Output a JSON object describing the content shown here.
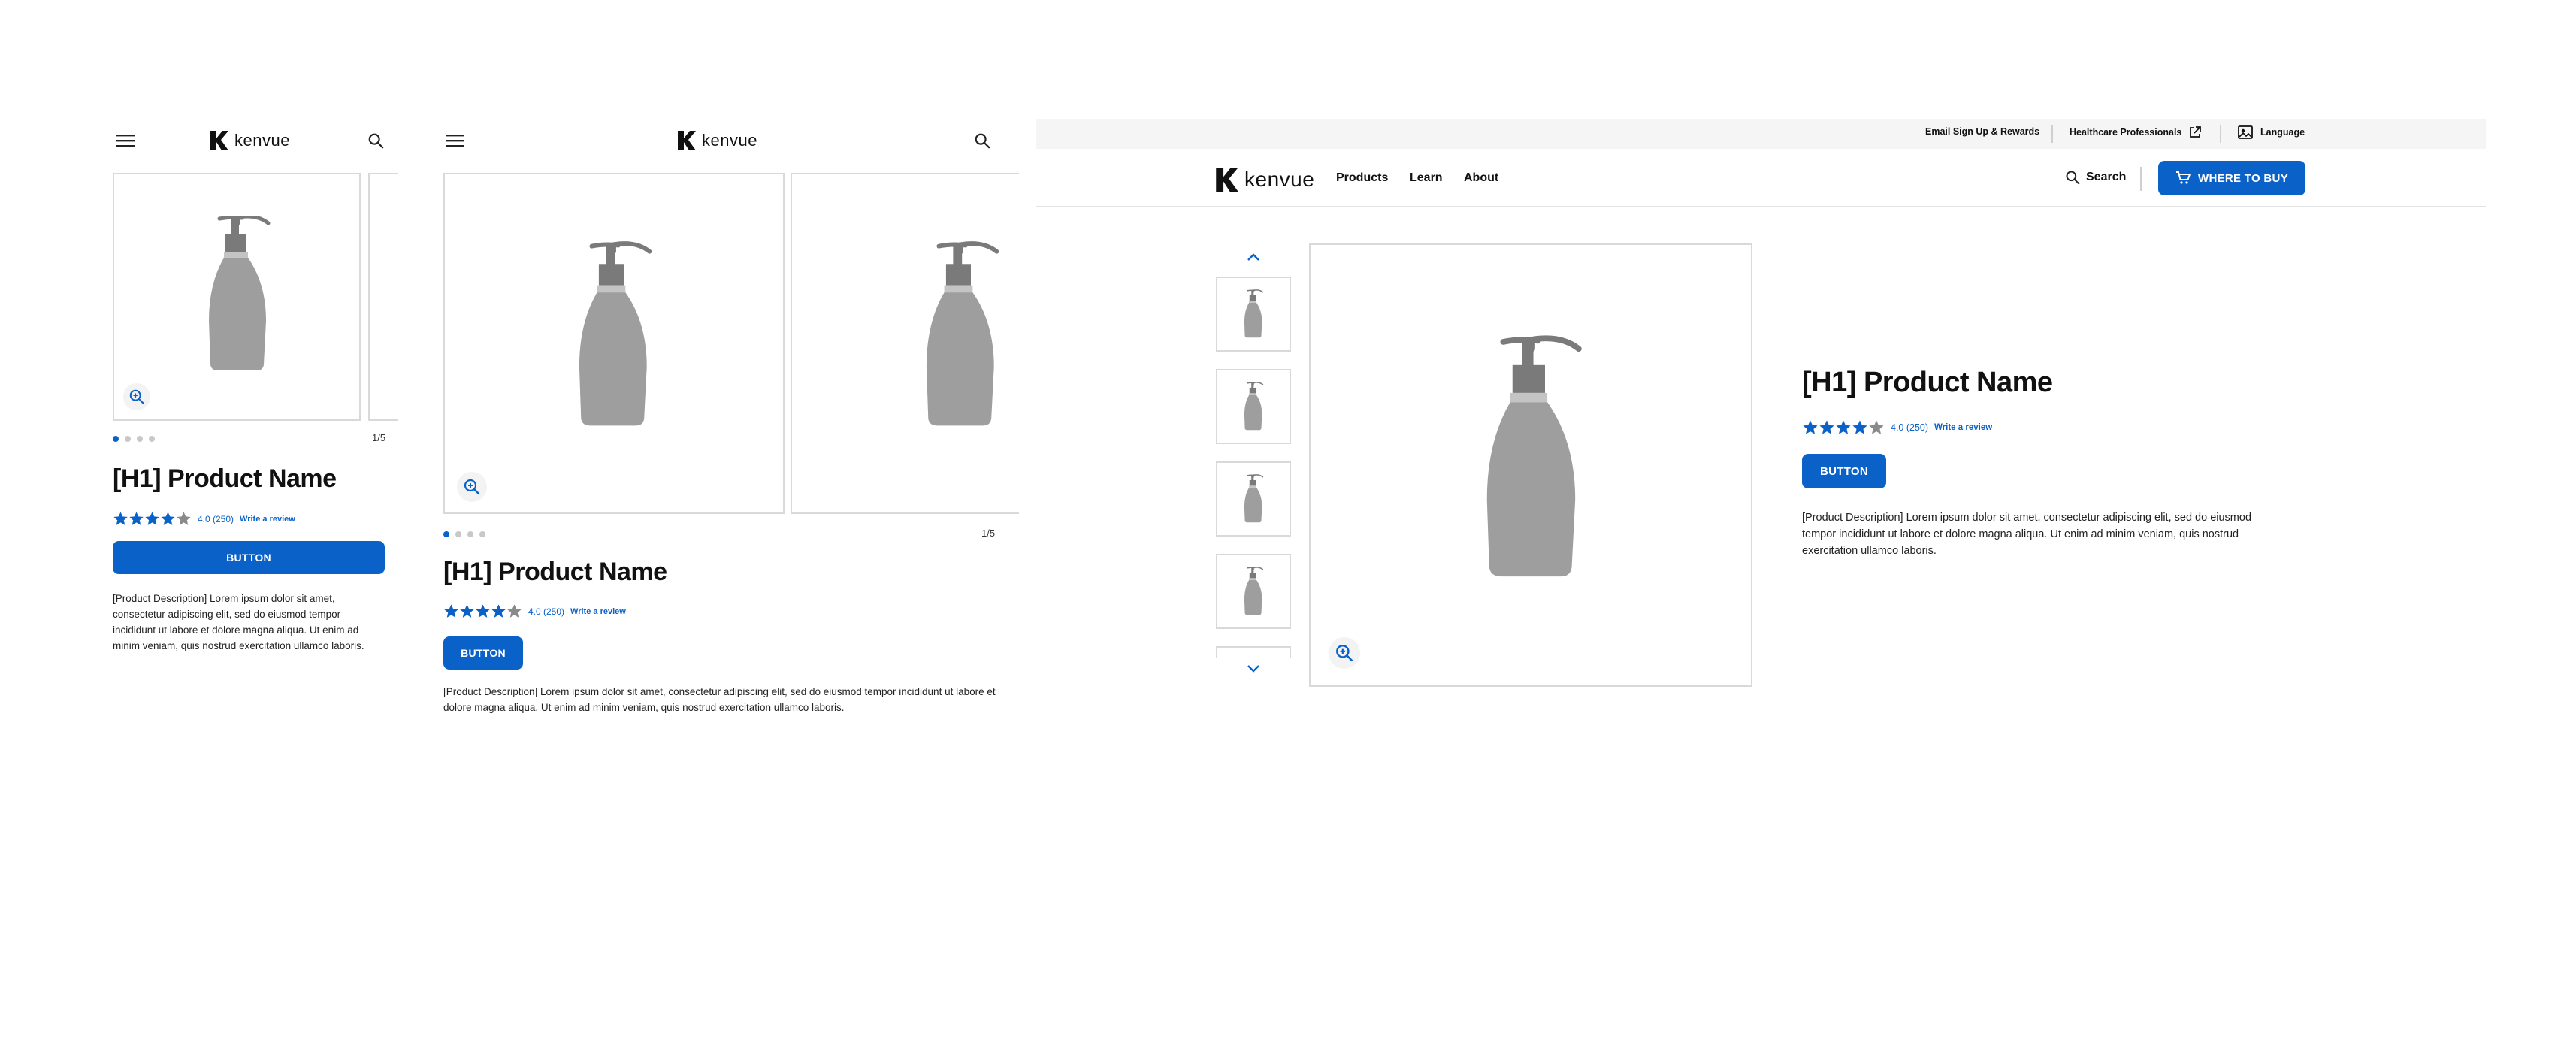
{
  "brand": {
    "name": "kenvue"
  },
  "product": {
    "title": "[H1] Product Name",
    "rating_value": 4.0,
    "rating_text": "4.0 (250)",
    "write_review": "Write a review",
    "button_label": "BUTTON",
    "description": "[Product Description] Lorem ipsum dolor sit amet, consectetur adipiscing elit, sed do eiusmod tempor incididunt ut labore et dolore magna aliqua. Ut enim ad minim veniam, quis nostrud exercitation ullamco laboris."
  },
  "gallery": {
    "counter": "1/5",
    "dot_count": 4,
    "active_dot": 0
  },
  "desktop": {
    "utility": {
      "email_signup": "Email Sign Up & Rewards",
      "healthcare": "Healthcare Professionals",
      "language": "Language"
    },
    "nav": {
      "products": "Products",
      "learn": "Learn",
      "about": "About"
    },
    "search_label": "Search",
    "where_to_buy": "WHERE TO BUY"
  },
  "colors": {
    "accent": "#0a62c9",
    "star_filled": "#0a62c9",
    "star_empty": "#8a8a8a",
    "product_gray": "#9e9e9e",
    "product_dark": "#7a7a7a",
    "border": "#d9d9d9"
  },
  "icons": {
    "menu": "hamburger-icon",
    "search": "search-icon",
    "zoom": "zoom-in-icon",
    "cart": "cart-icon",
    "external": "external-link-icon",
    "language": "language-icon",
    "up": "chevron-up-icon",
    "down": "chevron-down-icon",
    "star": "star-icon"
  }
}
